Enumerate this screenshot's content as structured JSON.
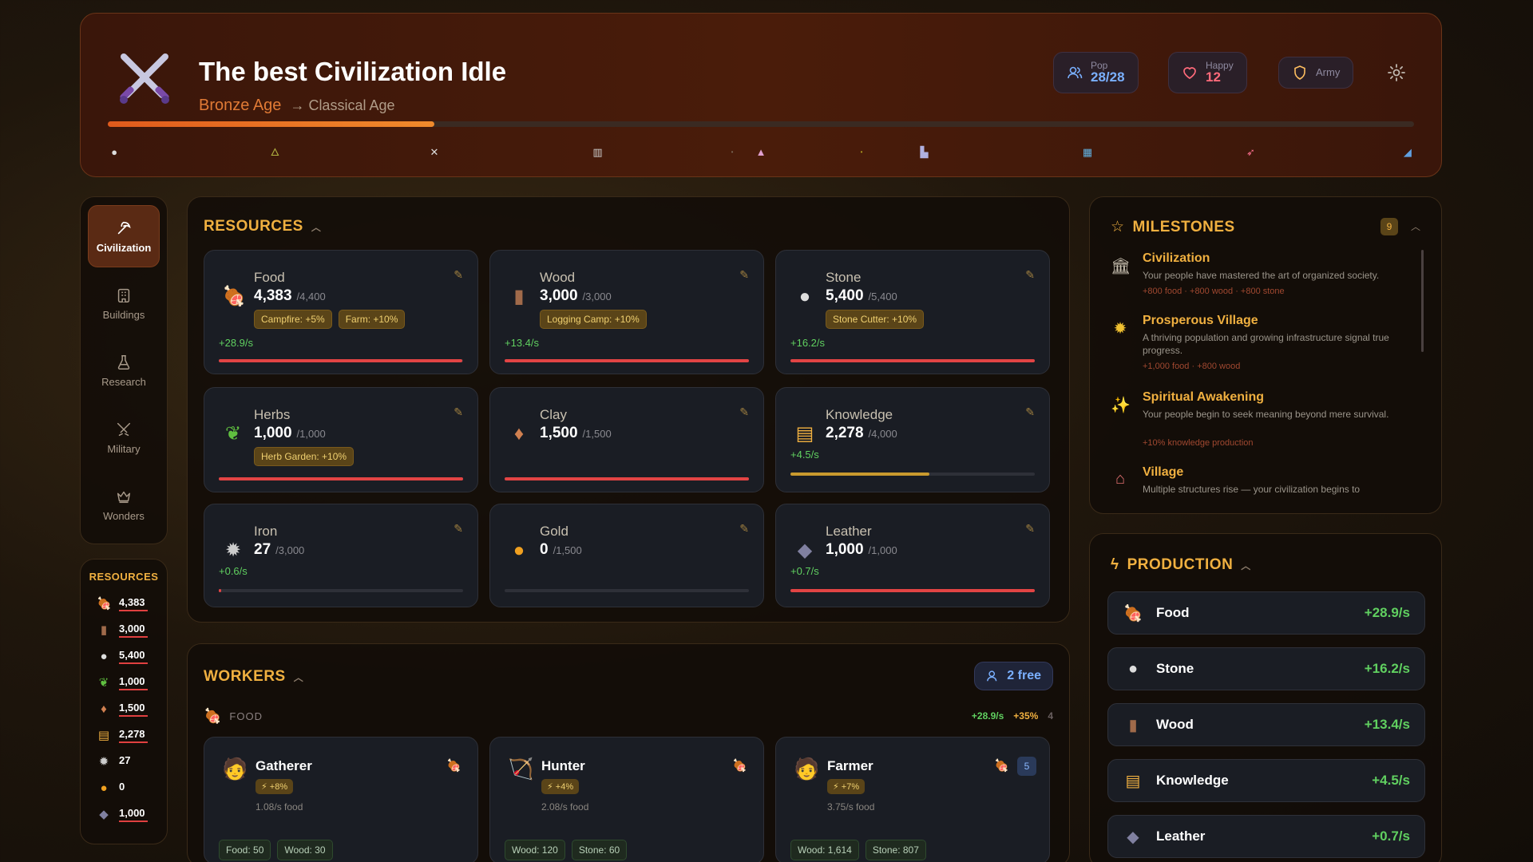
{
  "header": {
    "title": "The best Civilization Idle",
    "age": "Bronze Age",
    "next_age": "→ Classical Age",
    "pop_label": "Pop",
    "pop_value": "28/28",
    "happy_label": "Happy",
    "happy_value": "12",
    "army_label": "Army",
    "age_progress": 0.25,
    "colors": {
      "accent": "#e07a35",
      "pop": "#7ab0ff",
      "happy": "#ff6a7a"
    }
  },
  "nav": {
    "items": [
      {
        "label": "Civilization",
        "icon": "pickaxe-icon"
      },
      {
        "label": "Buildings",
        "icon": "building-icon"
      },
      {
        "label": "Research",
        "icon": "flask-icon"
      },
      {
        "label": "Military",
        "icon": "swords-icon"
      },
      {
        "label": "Wonders",
        "icon": "crown-icon"
      }
    ]
  },
  "mini": {
    "title": "RESOURCES",
    "items": [
      "4,383",
      "3,000",
      "5,400",
      "1,000",
      "1,500",
      "2,278",
      "27",
      "0",
      "1,000"
    ]
  },
  "resources": {
    "title": "RESOURCES",
    "cards": [
      {
        "name": "Food",
        "amount": "4,383",
        "cap": "/4,400",
        "tags": [
          "Campfire: +5%",
          "Farm: +10%"
        ],
        "rate": "+28.9/s",
        "fill": 0.996
      },
      {
        "name": "Wood",
        "amount": "3,000",
        "cap": "/3,000",
        "tags": [
          "Logging Camp: +10%"
        ],
        "rate": "+13.4/s",
        "fill": 1.0
      },
      {
        "name": "Stone",
        "amount": "5,400",
        "cap": "/5,400",
        "tags": [
          "Stone Cutter: +10%"
        ],
        "rate": "+16.2/s",
        "fill": 1.0
      },
      {
        "name": "Herbs",
        "amount": "1,000",
        "cap": "/1,000",
        "tags": [
          "Herb Garden: +10%"
        ],
        "rate": "",
        "fill": 1.0
      },
      {
        "name": "Clay",
        "amount": "1,500",
        "cap": "/1,500",
        "tags": [],
        "rate": "",
        "fill": 1.0
      },
      {
        "name": "Knowledge",
        "amount": "2,278",
        "cap": "/4,000",
        "tags": [],
        "rate": "+4.5/s",
        "fill": 0.57
      },
      {
        "name": "Iron",
        "amount": "27",
        "cap": "/3,000",
        "tags": [],
        "rate": "+0.6/s",
        "fill": 0.009
      },
      {
        "name": "Gold",
        "amount": "0",
        "cap": "/1,500",
        "tags": [],
        "rate": "",
        "fill": 0
      },
      {
        "name": "Leather",
        "amount": "1,000",
        "cap": "/1,000",
        "tags": [],
        "rate": "+0.7/s",
        "fill": 1.0
      }
    ]
  },
  "workers": {
    "title": "WORKERS",
    "free": "2 free",
    "category": "FOOD",
    "category_rate": "+28.9/s",
    "category_bonus": "+35%",
    "category_count": "4",
    "cards": [
      {
        "name": "Gatherer",
        "bonus": "⚡ +8%",
        "rate": "1.08/s food",
        "costs": [
          "Food: 50",
          "Wood: 30"
        ],
        "count": ""
      },
      {
        "name": "Hunter",
        "bonus": "⚡ +4%",
        "rate": "2.08/s food",
        "costs": [
          "Wood: 120",
          "Stone: 60"
        ],
        "count": ""
      },
      {
        "name": "Farmer",
        "bonus": "⚡ +7%",
        "rate": "3.75/s food",
        "costs": [
          "Wood: 1,614",
          "Stone: 807"
        ],
        "count": "5"
      }
    ]
  },
  "milestones": {
    "title": "MILESTONES",
    "count": "9",
    "items": [
      {
        "title": "Civilization",
        "desc": "Your people have mastered the art of organized society.",
        "reward": "+800 food · +800 wood · +800 stone"
      },
      {
        "title": "Prosperous Village",
        "desc": "A thriving population and growing infrastructure signal true progress.",
        "reward": "+1,000 food · +800 wood"
      },
      {
        "title": "Spiritual Awakening",
        "desc": "Your people begin to seek meaning beyond mere survival.",
        "reward": "+10% knowledge production"
      },
      {
        "title": "Village",
        "desc": "Multiple structures rise — your civilization begins to",
        "reward": ""
      }
    ]
  },
  "production": {
    "title": "PRODUCTION",
    "items": [
      {
        "name": "Food",
        "value": "+28.9/s"
      },
      {
        "name": "Stone",
        "value": "+16.2/s"
      },
      {
        "name": "Wood",
        "value": "+13.4/s"
      },
      {
        "name": "Knowledge",
        "value": "+4.5/s"
      },
      {
        "name": "Leather",
        "value": "+0.7/s"
      }
    ]
  }
}
